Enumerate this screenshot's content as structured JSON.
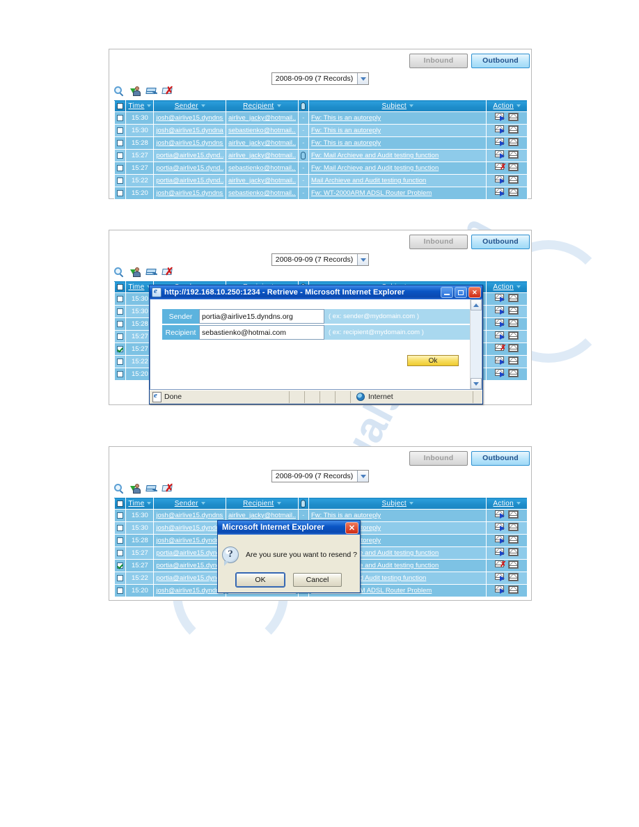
{
  "watermark": {
    "text1": "manualshive.com",
    "text2": "manualshive.com",
    "color": "#cfe0f2"
  },
  "theme": {
    "header_blue": "#1d8cc9",
    "row_odd": "#7dc2e4",
    "row_even": "#8ecbea",
    "tab_active_text": "#1e4f8a"
  },
  "screen": {
    "tabs": {
      "inbound": "Inbound",
      "outbound": "Outbound"
    },
    "date_filter": {
      "value": "2008-09-09 (7 Records)",
      "arrow": "chevron-down-icon"
    },
    "toolbar": [
      {
        "name": "search-icon",
        "title": "Search"
      },
      {
        "name": "user-add-icon",
        "title": "Retrieve by account"
      },
      {
        "name": "mail-forward-icon",
        "title": "Resend mail"
      },
      {
        "name": "mail-delete-icon",
        "title": "Delete mail"
      }
    ],
    "columns": {
      "select_all": "",
      "time": "Time",
      "sender": "Sender",
      "recipient": "Recipient",
      "attachment": "paperclip-icon",
      "subject": "Subject",
      "action": "Action"
    },
    "rows": [
      {
        "checked": false,
        "time": "15:30",
        "sender": "josh@airlive15.dyndns...",
        "recipient": "airlive_jacky@hotmail....",
        "attachment": "-",
        "has_attachment": false,
        "subject": "Fw: This is an autoreply",
        "resend_marked": false
      },
      {
        "checked": false,
        "time": "15:30",
        "sender": "josh@airlive15.dyndna...",
        "recipient": "sebastienko@hotmail...",
        "attachment": "-",
        "has_attachment": false,
        "subject": "Fw: This is an autoreply",
        "resend_marked": false
      },
      {
        "checked": false,
        "time": "15:28",
        "sender": "josh@airlive15.dyndns...",
        "recipient": "airlive_jacky@hotmail....",
        "attachment": "-",
        "has_attachment": false,
        "subject": "Fw: This is an autoreply",
        "resend_marked": false
      },
      {
        "checked": false,
        "time": "15:27",
        "sender": "portia@airlive15.dynd...",
        "recipient": "airlive_jacky@hotmail..",
        "attachment": "",
        "has_attachment": true,
        "subject": "Fw: Mail Archieve and Audit testing function",
        "resend_marked": false
      },
      {
        "checked": false,
        "time": "15:27",
        "sender": "portia@airlive15.dynd...",
        "recipient": "sebastienko@hotmail...",
        "attachment": "-",
        "has_attachment": false,
        "subject": "Fw: Mail Archieve and Audit testing function",
        "resend_marked": true
      },
      {
        "checked": false,
        "time": "15:22",
        "sender": "portia@airlive15.dynd....",
        "recipient": "airlive_jacky@hotmail....",
        "attachment": "-",
        "has_attachment": false,
        "subject": "Mail Archieve and Audit testing function",
        "resend_marked": false
      },
      {
        "checked": false,
        "time": "15:20",
        "sender": "josh@airlive15.dyndns...",
        "recipient": "sebastienko@hotmail...",
        "attachment": "-",
        "has_attachment": false,
        "subject": "Fw: WT-2000ARM ADSL Router Problem",
        "resend_marked": false
      }
    ],
    "rows_selected": [
      {
        "checked": false,
        "time": "15:30",
        "sender": "josh@airlive15.dyndns...",
        "recipient": "airlive_jacky@hotmail....",
        "attachment": "-",
        "has_attachment": false,
        "subject": "Fw: This is an autoreply",
        "resend_marked": false
      },
      {
        "checked": false,
        "time": "15:30",
        "sender": "josh@airlive15.dyndna...",
        "recipient": "sebastienko@hotmail...",
        "attachment": "-",
        "has_attachment": false,
        "subject": "Fw: This is an autoreply",
        "resend_marked": false
      },
      {
        "checked": false,
        "time": "15:28",
        "sender": "josh@airlive15.dyndns...",
        "recipient": "airlive_jacky@hotmail....",
        "attachment": "-",
        "has_attachment": false,
        "subject": "Fw: This is an autoreply",
        "resend_marked": false
      },
      {
        "checked": false,
        "time": "15:27",
        "sender": "portia@airlive15.dynd...",
        "recipient": "airlive_jacky@hotmail..",
        "attachment": "",
        "has_attachment": true,
        "subject": "Fw: Mail Archieve and Audit testing function",
        "resend_marked": false
      },
      {
        "checked": true,
        "time": "15:27",
        "sender": "portia@airlive15.dynd...",
        "recipient": "sebastienko@hotmail...",
        "attachment": "-",
        "has_attachment": false,
        "subject": "Fw: Mail Archieve and Audit testing function",
        "resend_marked": true
      },
      {
        "checked": false,
        "time": "15:22",
        "sender": "portia@airlive15.dynd....",
        "recipient": "airlive_jacky@hotmail....",
        "attachment": "-",
        "has_attachment": false,
        "subject": "Mail Archieve and Audit testing function",
        "resend_marked": false
      },
      {
        "checked": false,
        "time": "15:20",
        "sender": "josh@airlive15.dyndns...",
        "recipient": "sebastienko@hotmail...",
        "attachment": "-",
        "has_attachment": false,
        "subject": "Fw: WT-2000ARM ADSL Router Problem",
        "resend_marked": false
      }
    ]
  },
  "retrieve_window": {
    "title": "http://192.168.10.250:1234 - Retrieve - Microsoft Internet Explorer",
    "minimize": "_",
    "maximize": "□",
    "close": "✕",
    "fields": [
      {
        "label": "Sender",
        "value": "portia@airlive15.dyndns.org",
        "hint": "( ex: sender@mydomain.com )"
      },
      {
        "label": "Recipient",
        "value": "sebastienko@hotmai.com",
        "hint": "( ex: recipient@mydomain.com )"
      }
    ],
    "ok_button": "Ok",
    "status_left": "Done",
    "status_zone": "Internet"
  },
  "confirm_dialog": {
    "title": "Microsoft Internet Explorer",
    "close": "✕",
    "icon": "?",
    "message": "Are you sure you want to resend ?",
    "ok": "OK",
    "cancel": "Cancel"
  }
}
